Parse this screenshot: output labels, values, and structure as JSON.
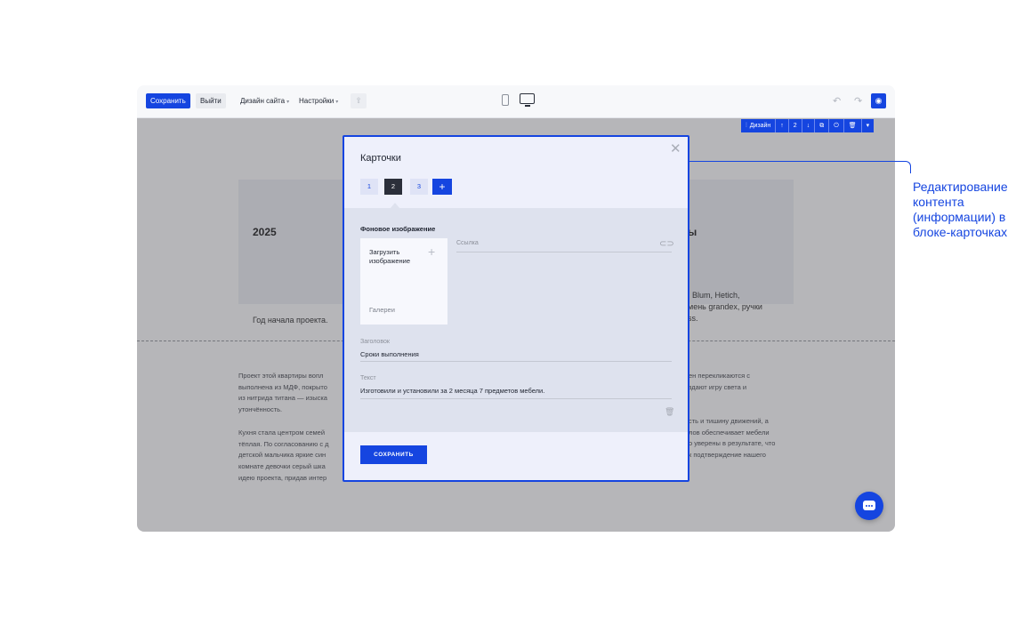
{
  "toolbar": {
    "save_label": "Сохранить",
    "exit_label": "Выйти",
    "site_design_label": "Дизайн сайта",
    "settings_label": "Настройки"
  },
  "block_panel": {
    "design_label": "Дизайн",
    "position": "2"
  },
  "page": {
    "left_card_year": "2025",
    "left_card_caption": "Год начала проекта.",
    "right_card_title": "ы",
    "right_card_text_1": ", Blum, Hetich,",
    "right_card_text_2": "мень grandex, ручки",
    "right_card_text_3": "ss.",
    "para_left_1": "Проект этой квартиры вопл",
    "para_left_2": "выполнена из МДФ, покрыто",
    "para_left_3": "из нитрида титана — изыска",
    "para_left_4": "утончённость.",
    "para_left_5": "Кухня стала центром семей",
    "para_left_6": "тёплая. По согласованию с д",
    "para_left_7": "детской мальчика яркие син",
    "para_left_8": "комнате девочки серый шка",
    "para_left_9": "идею проекта, придав интер",
    "para_right_1": "ен перекликаются с",
    "para_right_2": "здают игру света и",
    "para_right_3": "сть и тишину движений, а",
    "para_right_4": "лов обеспечивает мебели",
    "para_right_5": "о уверены в результате, что",
    "para_right_6": "к подтверждение нашего"
  },
  "modal": {
    "title": "Карточки",
    "tabs": [
      "1",
      "2",
      "3"
    ],
    "add_tab": "+",
    "section_title": "Фоновое изображение",
    "upload_label": "Загрузить изображение",
    "gallery_label": "Галереи",
    "link_label": "Ссылка",
    "heading_label": "Заголовок",
    "heading_value": "Сроки выполнения",
    "text_label": "Текст",
    "text_value": "Изготовили и установили за 2 месяца 7 предметов мебели.",
    "save_button": "СОХРАНИТЬ"
  },
  "callout": {
    "text": "Редактирование контента (информации) в блоке-карточках"
  },
  "icons": [
    "share-icon",
    "mobile-icon",
    "desktop-icon",
    "undo-icon",
    "redo-icon",
    "eye-icon",
    "close-icon",
    "link-icon",
    "trash-icon",
    "chat-icon",
    "arrow-up-icon",
    "arrow-down-icon",
    "copy-icon",
    "power-icon",
    "delete-icon",
    "chevron-down-icon"
  ],
  "colors": {
    "accent": "#1545e0",
    "modal_bg": "#eef0fb",
    "modal_body": "#dee2ee"
  }
}
